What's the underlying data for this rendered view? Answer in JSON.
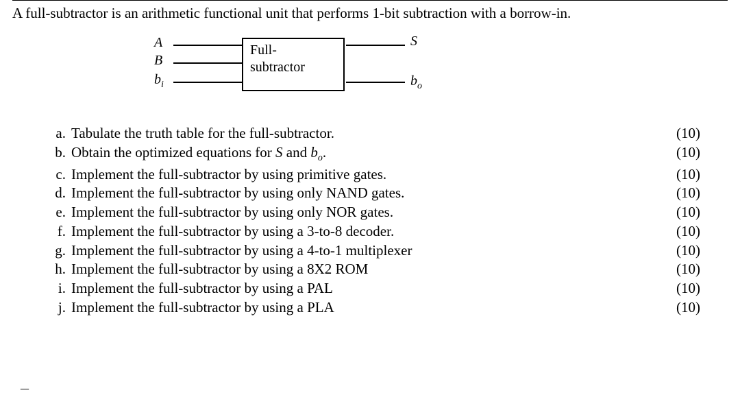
{
  "intro": "A full-subtractor is an arithmetic functional unit that performs 1-bit subtraction with a borrow-in.",
  "diagram": {
    "box_line1": "Full-",
    "box_line2": "subtractor",
    "in_A": "A",
    "in_B": "B",
    "in_bi_base": "b",
    "in_bi_sub": "i",
    "out_S": "S",
    "out_bo_base": "b",
    "out_bo_sub": "o"
  },
  "questions": [
    {
      "label": "a.",
      "text": "Tabulate the truth table for the full-subtractor.",
      "points": "(10)"
    },
    {
      "label": "b.",
      "text_html": "Obtain the optimized equations for <span class='ital'>S</span> and <span class='ital'>b<span class='sub'>o</span></span>.",
      "points": "(10)"
    },
    {
      "label": "c.",
      "text": "Implement the full-subtractor by using primitive gates.",
      "points": "(10)"
    },
    {
      "label": "d.",
      "text": "Implement the full-subtractor by using only NAND gates.",
      "points": "(10)"
    },
    {
      "label": "e.",
      "text": "Implement the full-subtractor by using only NOR gates.",
      "points": "(10)"
    },
    {
      "label": "f.",
      "text": "Implement the full-subtractor by using a 3-to-8 decoder.",
      "points": "(10)"
    },
    {
      "label": "g.",
      "text": "Implement the full-subtractor by using a 4-to-1 multiplexer",
      "points": "(10)"
    },
    {
      "label": "h.",
      "text": "Implement the full-subtractor by using a 8X2 ROM",
      "points": "(10)"
    },
    {
      "label": "i.",
      "text": "Implement the full-subtractor by using a PAL",
      "points": "(10)"
    },
    {
      "label": "j.",
      "text": "Implement the full-subtractor by using a PLA",
      "points": "(10)"
    }
  ],
  "footer_dash": "–"
}
